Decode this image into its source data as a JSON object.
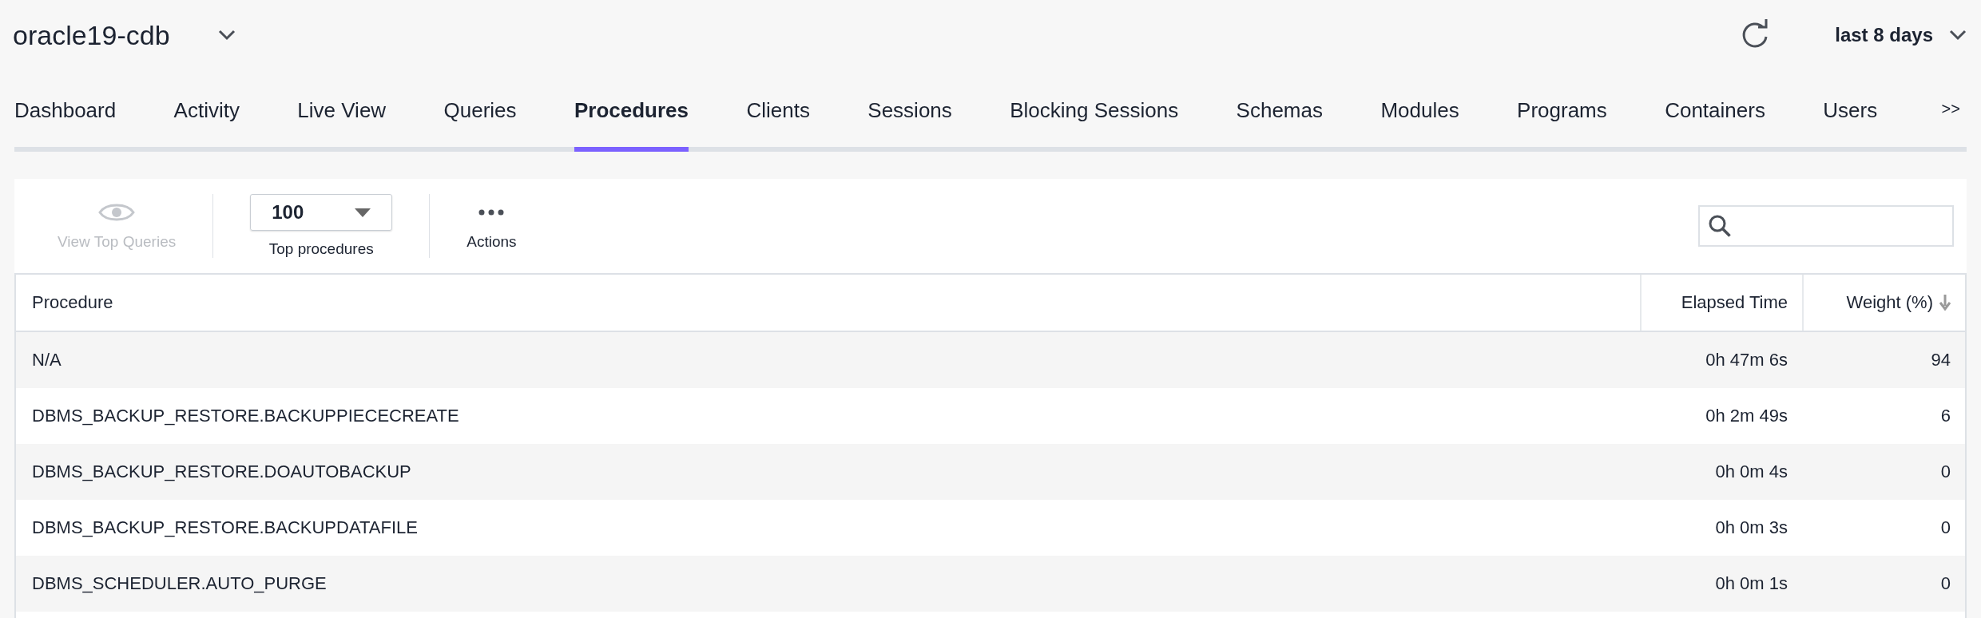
{
  "header": {
    "database": "oracle19-cdb",
    "time_range": "last 8 days"
  },
  "tabs": [
    {
      "label": "Dashboard",
      "selected": false
    },
    {
      "label": "Activity",
      "selected": false
    },
    {
      "label": "Live View",
      "selected": false
    },
    {
      "label": "Queries",
      "selected": false
    },
    {
      "label": "Procedures",
      "selected": true
    },
    {
      "label": "Clients",
      "selected": false
    },
    {
      "label": "Sessions",
      "selected": false
    },
    {
      "label": "Blocking Sessions",
      "selected": false
    },
    {
      "label": "Schemas",
      "selected": false
    },
    {
      "label": "Modules",
      "selected": false
    },
    {
      "label": "Programs",
      "selected": false
    },
    {
      "label": "Containers",
      "selected": false
    },
    {
      "label": "Users",
      "selected": false
    }
  ],
  "more_tabs": ">>",
  "toolbar": {
    "view_top_queries": {
      "label": "View Top Queries",
      "disabled": true
    },
    "top_select": {
      "value": "100",
      "label": "Top procedures"
    },
    "actions": {
      "label": "Actions"
    }
  },
  "table": {
    "columns": [
      "Procedure",
      "Elapsed Time",
      "Weight (%)"
    ],
    "rows": [
      [
        "N/A",
        "0h 47m 6s",
        "94"
      ],
      [
        "DBMS_BACKUP_RESTORE.BACKUPPIECECREATE",
        "0h 2m 49s",
        "6"
      ],
      [
        "DBMS_BACKUP_RESTORE.DOAUTOBACKUP",
        "0h 0m 4s",
        "0"
      ],
      [
        "DBMS_BACKUP_RESTORE.BACKUPDATAFILE",
        "0h 0m 3s",
        "0"
      ],
      [
        "DBMS_SCHEDULER.AUTO_PURGE",
        "0h 0m 1s",
        "0"
      ]
    ]
  }
}
